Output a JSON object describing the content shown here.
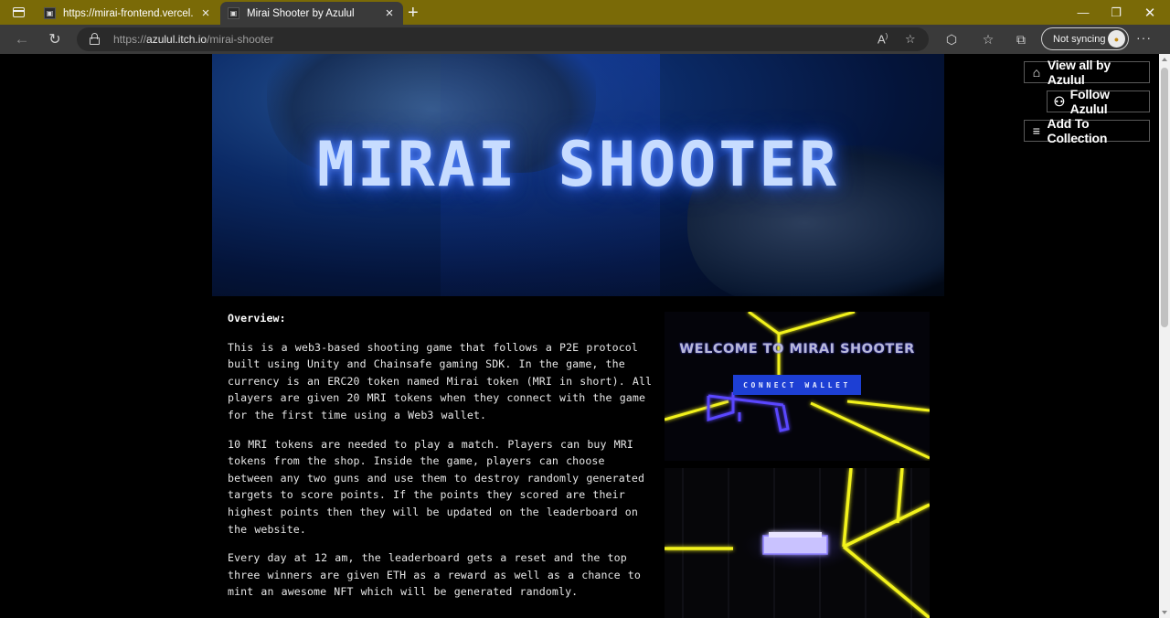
{
  "browser": {
    "tabs": [
      {
        "title": "https://mirai-frontend.vercel.app",
        "active": false
      },
      {
        "title": "Mirai Shooter by Azulul",
        "active": true
      }
    ],
    "address": {
      "scheme": "https://",
      "host": "azulul.itch.io",
      "path": "/mirai-shooter"
    },
    "sync_label": "Not syncing"
  },
  "sidebar": {
    "view_all": "View all by Azulul",
    "follow": "Follow Azulul",
    "add_collection": "Add To Collection"
  },
  "banner": {
    "title": "MIRAI SHOOTER"
  },
  "content": {
    "heading": "Overview:",
    "paragraphs": [
      "This is a web3-based shooting game that follows a P2E protocol built using Unity and Chainsafe gaming SDK.  In the game, the currency is an ERC20 token named Mirai token (MRI in short). All players are given 20 MRI tokens when they connect with the game for the first time using a Web3 wallet.",
      "10 MRI tokens are needed to play a match. Players can buy MRI tokens from the shop. Inside the game, players can choose between any two guns and use them to destroy randomly generated targets to score points. If the points they scored are their highest points then they will be updated on the leaderboard on the website.",
      "Every day at 12 am, the leaderboard gets a reset and the top three winners are given ETH as a reward as well as a chance to mint an awesome NFT which will be generated randomly."
    ]
  },
  "screenshots": {
    "shot1": {
      "title": "WELCOME TO MIRAI SHOOTER",
      "button": "CONNECT WALLET"
    }
  },
  "colors": {
    "tabbar": "#7a6a07",
    "toolbar": "#3a3a3a",
    "page_bg": "#000000",
    "neon_yellow": "#f2f21a",
    "neon_blue": "#1d3fd4"
  }
}
